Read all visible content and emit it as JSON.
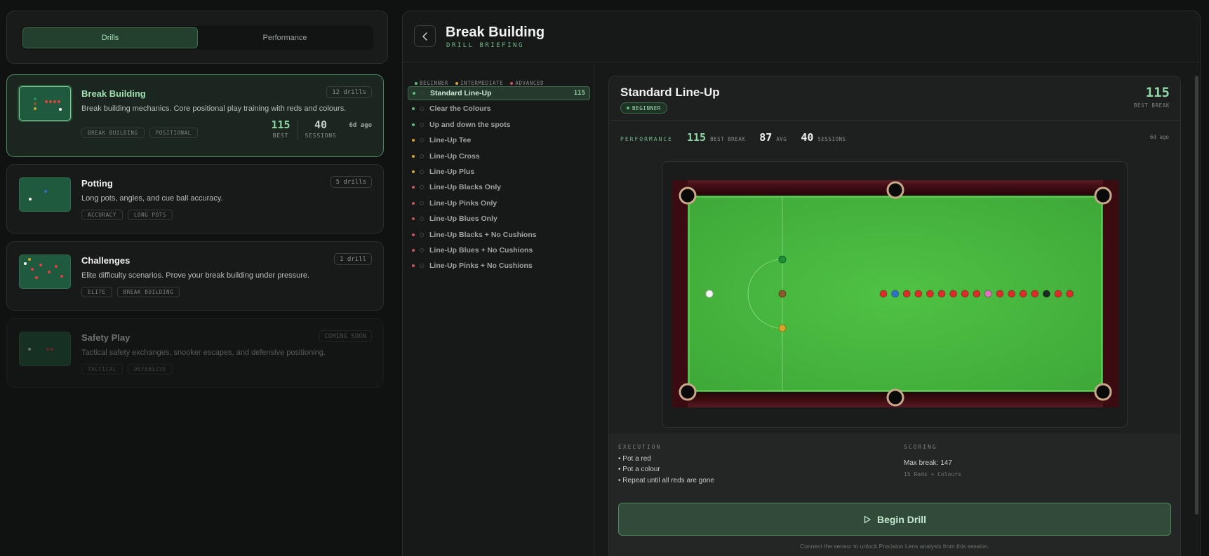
{
  "tabs": [
    {
      "label": "Drills",
      "active": true
    },
    {
      "label": "Performance",
      "active": false
    }
  ],
  "categories": [
    {
      "title": "Break Building",
      "desc": "Break building mechanics. Core positional play training with reds and colours.",
      "badge": "12 drills",
      "tags": [
        "BREAK BUILDING",
        "POSITIONAL"
      ],
      "best": "115",
      "best_label": "BEST",
      "sessions": "40",
      "sessions_label": "SESSIONS",
      "ago": "6d ago"
    },
    {
      "title": "Potting",
      "desc": "Long pots, angles, and cue ball accuracy.",
      "badge": "5 drills",
      "tags": [
        "ACCURACY",
        "LONG POTS"
      ]
    },
    {
      "title": "Challenges",
      "desc": "Elite difficulty scenarios. Prove your break building under pressure.",
      "badge": "1 drill",
      "tags": [
        "ELITE",
        "BREAK BUILDING"
      ]
    },
    {
      "title": "Safety Play",
      "desc": "Tactical safety exchanges, snooker escapes, and defensive positioning.",
      "badge": "COMING SOON",
      "tags": [
        "TACTICAL",
        "DEFENSIVE"
      ]
    }
  ],
  "header": {
    "title": "Break Building",
    "subtitle": "DRILL BRIEFING"
  },
  "legend": [
    {
      "label": "BEGINNER",
      "color": "#5fbf7a"
    },
    {
      "label": "INTERMEDIATE",
      "color": "#d4a72c"
    },
    {
      "label": "ADVANCED",
      "color": "#d0525f"
    }
  ],
  "drills": [
    {
      "name": "Standard Line-Up",
      "level": "beginner",
      "score": "115"
    },
    {
      "name": "Clear the Colours",
      "level": "beginner",
      "score": ""
    },
    {
      "name": "Up and down the spots",
      "level": "beginner",
      "score": ""
    },
    {
      "name": "Line-Up Tee",
      "level": "intermediate",
      "score": ""
    },
    {
      "name": "Line-Up Cross",
      "level": "intermediate",
      "score": ""
    },
    {
      "name": "Line-Up Plus",
      "level": "intermediate",
      "score": ""
    },
    {
      "name": "Line-Up Blacks Only",
      "level": "advanced",
      "score": ""
    },
    {
      "name": "Line-Up Pinks Only",
      "level": "advanced",
      "score": ""
    },
    {
      "name": "Line-Up Blues Only",
      "level": "advanced",
      "score": ""
    },
    {
      "name": "Line-Up Blacks + No Cushions",
      "level": "advanced",
      "score": ""
    },
    {
      "name": "Line-Up Blues + No Cushions",
      "level": "advanced",
      "score": ""
    },
    {
      "name": "Line-Up Pinks + No Cushions",
      "level": "advanced",
      "score": ""
    }
  ],
  "detail": {
    "title": "Standard Line-Up",
    "level": "BEGINNER",
    "best": "115",
    "best_label": "BEST BREAK",
    "perf_label": "PERFORMANCE",
    "perf_best": "115",
    "perf_best_unit": "BEST BREAK",
    "perf_avg": "87",
    "perf_avg_unit": "AVG",
    "perf_sessions": "40",
    "perf_sessions_unit": "SESSIONS",
    "ago": "6d ago",
    "execution_label": "EXECUTION",
    "execution": [
      "• Pot a red",
      "• Pot a colour",
      "• Repeat until all reds are gone"
    ],
    "scoring_label": "SCORING",
    "scoring_max": "Max break: 147",
    "scoring_sub": "15 Reds + Colours",
    "begin_label": "Begin Drill",
    "footnote": "Connect the sensor to unlock Precision Lens analysis from this session."
  },
  "line_balls": [
    "red",
    "blue",
    "red",
    "red",
    "red",
    "red",
    "red",
    "red",
    "red",
    "pink",
    "red",
    "red",
    "red",
    "red",
    "black",
    "red",
    "red"
  ],
  "colors": {
    "accent": "#8fd6a4",
    "felt": "#48b93f",
    "cushion": "#3a0c12"
  }
}
